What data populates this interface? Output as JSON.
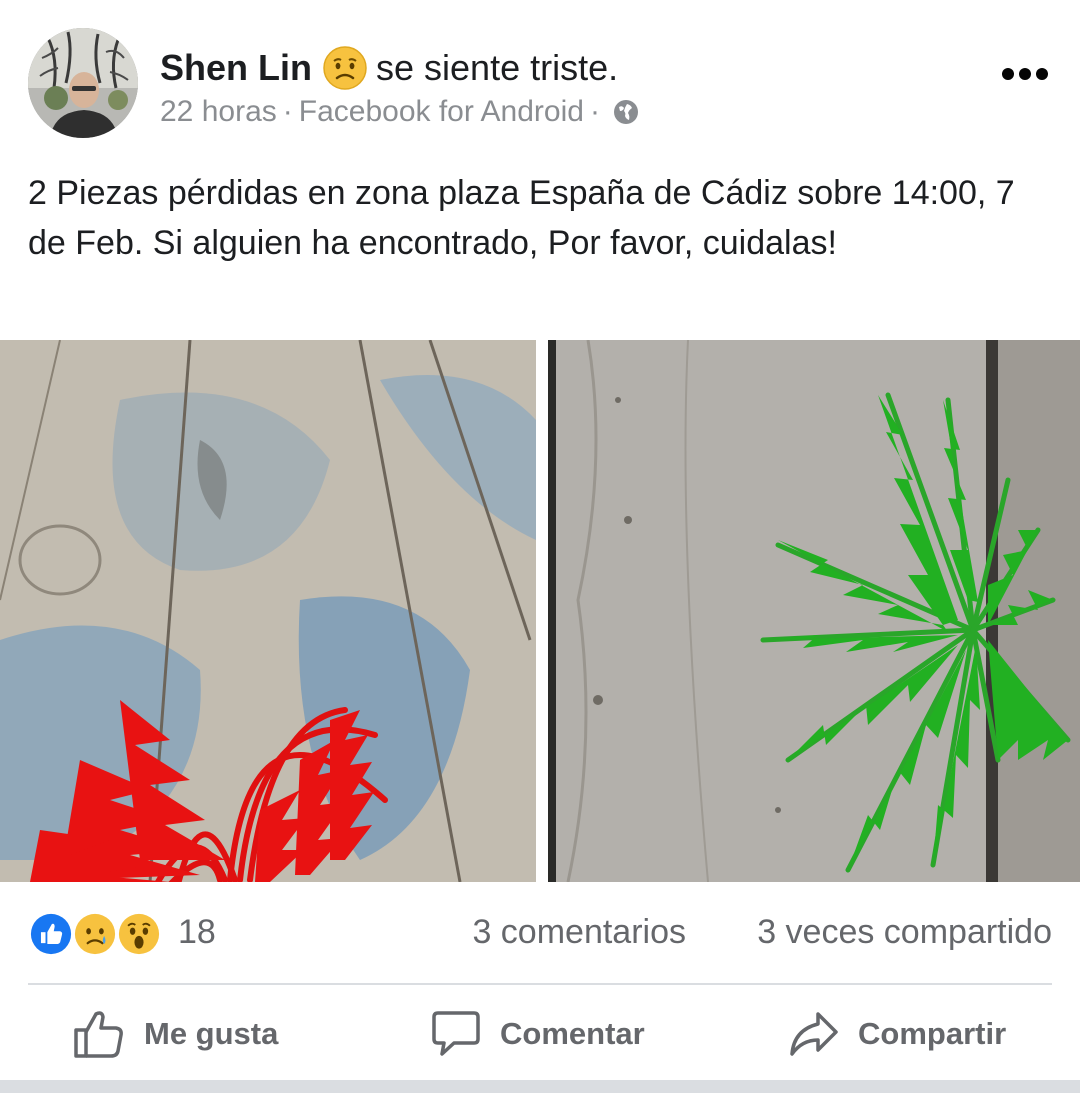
{
  "post": {
    "author": "Shen Lin",
    "feeling": "se siente triste.",
    "feeling_icon": "sad-face-emoji",
    "time": "22 horas",
    "separator": "·",
    "source": "Facebook for Android",
    "privacy_icon": "globe-icon",
    "text": "2 Piezas pérdidas en zona plaza España de Cádiz sobre 14:00, 7 de Feb. Si alguien ha encontrado, Por favor, cuidalas!",
    "photos": [
      {
        "subject": "red-plant-piece"
      },
      {
        "subject": "green-plant-piece"
      }
    ]
  },
  "stats": {
    "reaction_icons": [
      "like",
      "sad",
      "wow"
    ],
    "reaction_count": "18",
    "comments": "3 comentarios",
    "shares": "3 veces compartido"
  },
  "actions": {
    "like": "Me gusta",
    "comment": "Comentar",
    "share": "Compartir"
  },
  "colors": {
    "like_blue": "#1877f2",
    "secondary_text": "#65676b",
    "meta_text": "#8a8d91",
    "divider": "#dadde1"
  }
}
